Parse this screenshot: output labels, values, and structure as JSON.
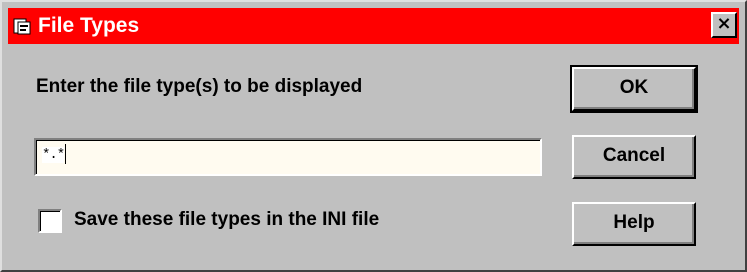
{
  "window": {
    "title": "File Types",
    "titlebar_color": "#ff0000",
    "icon": "folder-app-icon",
    "close_label": "×"
  },
  "form": {
    "prompt": "Enter the file type(s) to be displayed",
    "file_type_value": "*.*",
    "save_checkbox_label": "Save these file types in the INI file",
    "save_checked": false
  },
  "buttons": {
    "ok": "OK",
    "cancel": "Cancel",
    "help": "Help"
  }
}
